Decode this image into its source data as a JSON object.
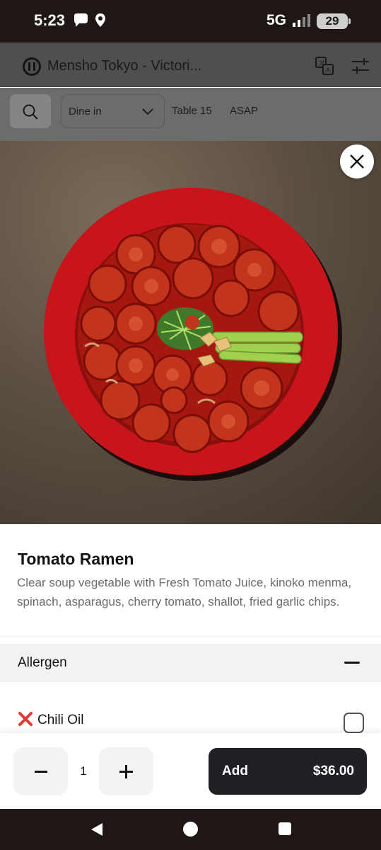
{
  "status_bar": {
    "time": "5:23",
    "network": "5G",
    "battery": "29",
    "icons": [
      "chat-bubble-icon",
      "location-pin-icon",
      "signal-icon"
    ]
  },
  "header": {
    "restaurant_name": "Mensho Tokyo - Victori...",
    "icons": [
      "brand-logo-icon",
      "translate-icon",
      "filter-sliders-icon"
    ]
  },
  "filters": {
    "dine_option": "Dine in",
    "table": "Table 15",
    "time": "ASAP"
  },
  "item": {
    "name": "Tomato Ramen",
    "description": "Clear soup vegetable with Fresh Tomato Juice, kinoko menma, spinach, asparagus, cherry tomato, shallot, fried garlic chips."
  },
  "allergen": {
    "title": "Allergen",
    "expanded": true,
    "options": [
      {
        "label": "Chili Oil",
        "checked": false,
        "icon": "red-x-icon"
      }
    ]
  },
  "order": {
    "quantity": "1",
    "add_label": "Add",
    "price": "$36.00"
  },
  "colors": {
    "overlay_dim": "#4f4f4f",
    "button_dark": "#1f2125",
    "bowl_red": "#c8151b",
    "accent_x": "#e53935"
  }
}
